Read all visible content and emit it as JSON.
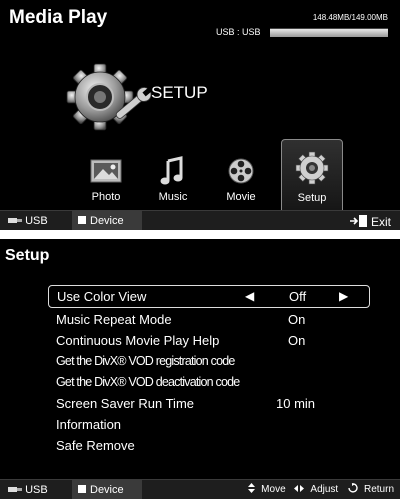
{
  "top": {
    "app_title": "Media Play",
    "usb_label": "USB : USB",
    "storage_text": "148.48MB/149.00MB",
    "storage_fraction": 0.9965,
    "heading": "SETUP",
    "tabs": [
      {
        "label": "Photo",
        "icon": "photo-icon"
      },
      {
        "label": "Music",
        "icon": "music-note-icon"
      },
      {
        "label": "Movie",
        "icon": "film-reel-icon"
      },
      {
        "label": "Setup",
        "icon": "gear-icon"
      }
    ],
    "selected_tab": "Setup",
    "footer": {
      "usb": "USB",
      "device": "Device",
      "exit": "Exit"
    }
  },
  "setup": {
    "title": "Setup",
    "items": [
      {
        "label": "Use Color View",
        "value": "Off",
        "left_arrow": "◀",
        "right_arrow": "▶"
      },
      {
        "label": "Music Repeat Mode",
        "value": "On"
      },
      {
        "label": "Continuous Movie Play Help",
        "value": "On"
      },
      {
        "label": "Get the DivX® VOD registration code",
        "value": ""
      },
      {
        "label": "Get the DivX® VOD deactivation code",
        "value": ""
      },
      {
        "label": "Screen Saver Run Time",
        "value": "10 min"
      },
      {
        "label": "Information",
        "value": ""
      },
      {
        "label": "Safe Remove",
        "value": ""
      }
    ],
    "footer": {
      "usb": "USB",
      "device": "Device",
      "move": "Move",
      "adjust": "Adjust",
      "return": "Return"
    }
  },
  "colors": {
    "panel_bg": "#000000",
    "footer_bg": "#1e1e1e",
    "highlight_border": "#dddddd"
  }
}
